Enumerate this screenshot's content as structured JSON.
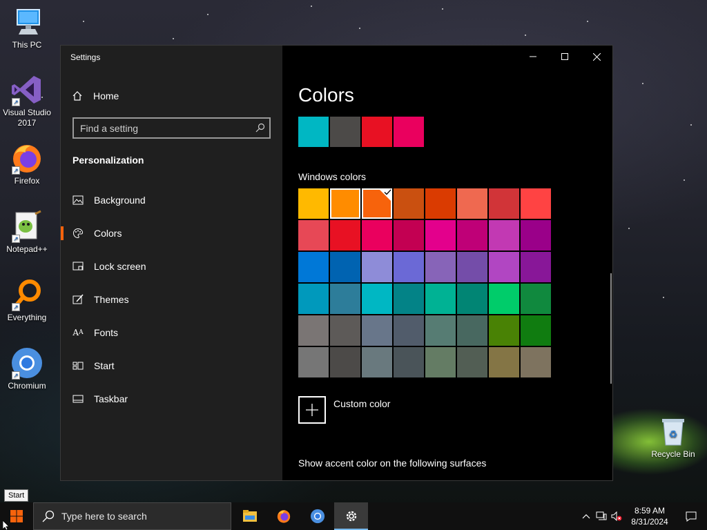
{
  "desktop": {
    "icons": [
      {
        "label": "This PC",
        "icon": "this-pc-icon"
      },
      {
        "label": "Visual Studio 2017",
        "icon": "visual-studio-icon"
      },
      {
        "label": "Firefox",
        "icon": "firefox-icon"
      },
      {
        "label": "Notepad++",
        "icon": "notepad-plus-plus-icon"
      },
      {
        "label": "Everything",
        "icon": "everything-icon"
      },
      {
        "label": "Chromium",
        "icon": "chromium-icon"
      },
      {
        "label": "Recycle Bin",
        "icon": "recycle-bin-icon"
      }
    ]
  },
  "window": {
    "title": "Settings",
    "controls": [
      "minimize",
      "maximize",
      "close"
    ]
  },
  "sidebar": {
    "home_label": "Home",
    "search_placeholder": "Find a setting",
    "section": "Personalization",
    "items": [
      {
        "label": "Background",
        "icon": "background-icon",
        "active": false
      },
      {
        "label": "Colors",
        "icon": "colors-icon",
        "active": true
      },
      {
        "label": "Lock screen",
        "icon": "lock-screen-icon",
        "active": false
      },
      {
        "label": "Themes",
        "icon": "themes-icon",
        "active": false
      },
      {
        "label": "Fonts",
        "icon": "fonts-icon",
        "active": false
      },
      {
        "label": "Start",
        "icon": "start-icon",
        "active": false
      },
      {
        "label": "Taskbar",
        "icon": "taskbar-icon",
        "active": false
      }
    ]
  },
  "content": {
    "title": "Colors",
    "recent_colors": [
      "#00b7c3",
      "#4c4a48",
      "#e81123",
      "#ea005e"
    ],
    "windows_colors_label": "Windows colors",
    "windows_colors": [
      [
        "#ffb900",
        "#ff8c00",
        "#f7630c",
        "#ca5010",
        "#da3b01",
        "#ef6950",
        "#d13438",
        "#ff4343"
      ],
      [
        "#e74856",
        "#e81123",
        "#ea005e",
        "#c30052",
        "#e3008c",
        "#bf0077",
        "#c239b3",
        "#9a0089"
      ],
      [
        "#0078d7",
        "#0063b1",
        "#8e8cd8",
        "#6b69d6",
        "#8764b8",
        "#744da9",
        "#b146c2",
        "#881798"
      ],
      [
        "#0099bc",
        "#2d7d9a",
        "#00b7c3",
        "#038387",
        "#00b294",
        "#018574",
        "#00cc6a",
        "#10893e"
      ],
      [
        "#7a7574",
        "#5d5a58",
        "#68768a",
        "#515c6b",
        "#567c73",
        "#486860",
        "#498205",
        "#107c10"
      ],
      [
        "#767676",
        "#4c4a48",
        "#69797e",
        "#4a5459",
        "#647c64",
        "#525e54",
        "#847545",
        "#7e735f"
      ]
    ],
    "hovered_color_index": 1,
    "selected_color_index": 2,
    "custom_color_label": "Custom color",
    "show_accent_label": "Show accent color on the following surfaces"
  },
  "tooltip": "Start",
  "taskbar": {
    "search_placeholder": "Type here to search",
    "apps": [
      {
        "name": "File Explorer",
        "icon": "file-explorer-icon"
      },
      {
        "name": "Firefox",
        "icon": "firefox-icon"
      },
      {
        "name": "Chromium",
        "icon": "chromium-icon"
      },
      {
        "name": "Settings",
        "icon": "settings-gear-icon"
      }
    ],
    "time": "8:59 AM",
    "date": "8/31/2024"
  }
}
